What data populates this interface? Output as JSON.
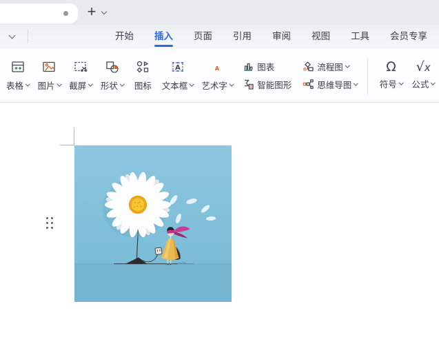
{
  "tab_bar": {
    "document_tab": {
      "unsaved_indicator": true
    },
    "new_tab_glyph": "+",
    "icons": {
      "new_tab": "plus-icon",
      "tab_list": "chevron-down-icon"
    }
  },
  "menu_bar": {
    "collapse_icon": "chevron-down-icon",
    "active_color": "#2f66e8",
    "tabs": [
      {
        "label": "开始",
        "active": false
      },
      {
        "label": "插入",
        "active": true
      },
      {
        "label": "页面",
        "active": false
      },
      {
        "label": "引用",
        "active": false
      },
      {
        "label": "审阅",
        "active": false
      },
      {
        "label": "视图",
        "active": false
      },
      {
        "label": "工具",
        "active": false
      },
      {
        "label": "会员专享",
        "active": false
      }
    ]
  },
  "ribbon": {
    "large_buttons": [
      {
        "label": "表格",
        "dropdown": true,
        "icon": "table-icon"
      },
      {
        "label": "图片",
        "dropdown": true,
        "icon": "picture-icon"
      },
      {
        "label": "截屏",
        "dropdown": true,
        "icon": "screenshot-icon"
      },
      {
        "label": "形状",
        "dropdown": true,
        "icon": "shapes-icon"
      },
      {
        "label": "图标",
        "dropdown": false,
        "icon": "icon-library-icon"
      },
      {
        "label": "文本框",
        "dropdown": true,
        "icon": "text-box-icon"
      },
      {
        "label": "艺术字",
        "dropdown": true,
        "icon": "word-art-icon"
      }
    ],
    "small_buttons": [
      {
        "label": "图表",
        "dropdown": false,
        "icon": "chart-icon"
      },
      {
        "label": "智能图形",
        "dropdown": false,
        "icon": "smart-art-icon"
      },
      {
        "label": "流程图",
        "dropdown": true,
        "icon": "flowchart-icon"
      },
      {
        "label": "思维导图",
        "dropdown": true,
        "icon": "mind-map-icon"
      }
    ],
    "symbol_buttons": [
      {
        "label": "符号",
        "dropdown": true,
        "glyph": "Ω",
        "icon": "omega-icon"
      },
      {
        "label": "公式",
        "dropdown": true,
        "glyph_radical": "√",
        "glyph_var": "x",
        "icon": "formula-icon"
      }
    ],
    "accent_colors": {
      "green": "#1f7a4d",
      "orange": "#e2601f",
      "blue_handles": "#4a7df8"
    }
  },
  "document": {
    "inline_image": {
      "name": "daisy-and-girl-illustration",
      "colors": {
        "background": "#84c1db",
        "petals": "#fdfdfd",
        "flower_center": "#f2b525",
        "dress": "#e9b94d",
        "scarf": "#c13187"
      }
    }
  }
}
